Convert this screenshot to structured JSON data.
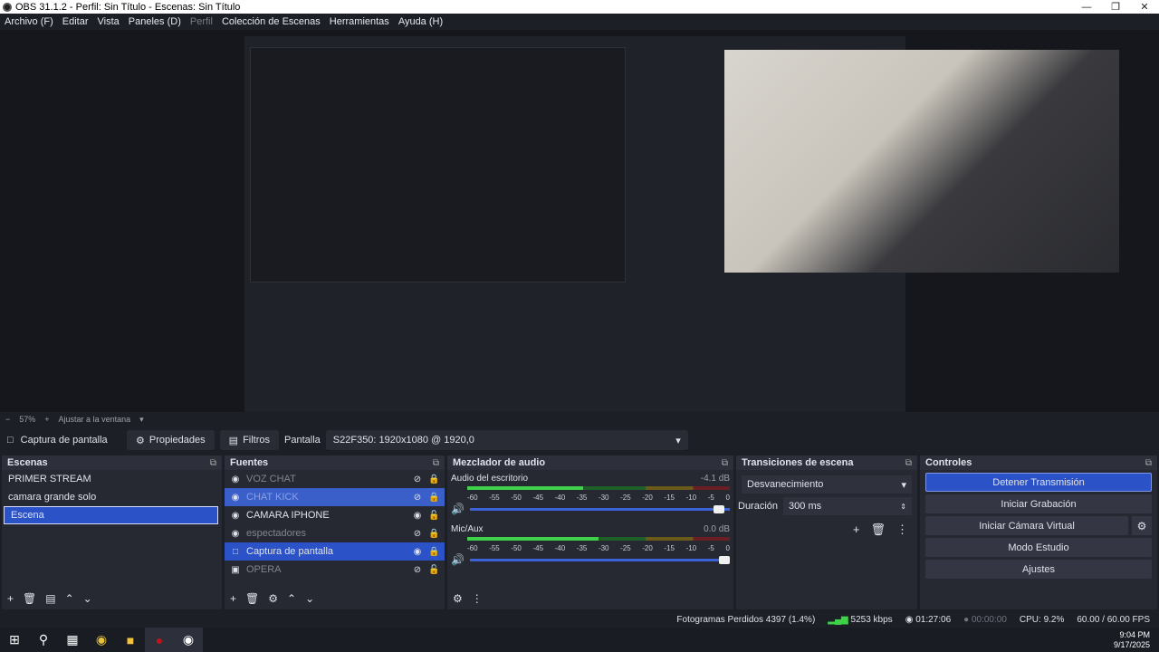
{
  "window": {
    "title": "OBS 31.1.2 - Perfil: Sin Título - Escenas: Sin Título"
  },
  "menu": [
    "Archivo (F)",
    "Editar",
    "Vista",
    "Paneles (D)",
    "Perfil",
    "Colección de Escenas",
    "Herramientas",
    "Ayuda (H)"
  ],
  "zoom": {
    "percent": "57%",
    "fit": "Ajustar a la ventana"
  },
  "source_toolbar": {
    "selected_source": "Captura de pantalla",
    "properties": "Propiedades",
    "filters": "Filtros",
    "display_label": "Pantalla",
    "display_value": "S22F350: 1920x1080 @ 1920,0"
  },
  "scenes": {
    "title": "Escenas",
    "items": [
      "PRIMER STREAM",
      "camara grande solo",
      "Escena"
    ]
  },
  "sources": {
    "title": "Fuentes",
    "items": [
      {
        "name": "VOZ CHAT"
      },
      {
        "name": "CHAT KICK"
      },
      {
        "name": "CAMARA IPHONE"
      },
      {
        "name": "espectadores"
      },
      {
        "name": "Captura de pantalla"
      },
      {
        "name": "OPERA"
      }
    ]
  },
  "mixer": {
    "title": "Mezclador de audio",
    "channels": [
      {
        "name": "Audio del escritorio",
        "db": "-4.1 dB",
        "level": 0.44,
        "volume": 0.98
      },
      {
        "name": "Mic/Aux",
        "db": "0.0 dB",
        "level": 0.5,
        "volume": 1.0
      }
    ],
    "ticks": [
      "-60",
      "-55",
      "-50",
      "-45",
      "-40",
      "-35",
      "-30",
      "-25",
      "-20",
      "-15",
      "-10",
      "-5",
      "0"
    ]
  },
  "transitions": {
    "title": "Transiciones de escena",
    "type": "Desvanecimiento",
    "duration_label": "Duración",
    "duration_value": "300 ms"
  },
  "controls": {
    "title": "Controles",
    "stop_stream": "Detener Transmisión",
    "start_recording": "Iniciar Grabación",
    "virtual_cam": "Iniciar Cámara Virtual",
    "studio_mode": "Modo Estudio",
    "settings": "Ajustes"
  },
  "status": {
    "dropped": "Fotogramas Perdidos 4397 (1.4%)",
    "bitrate": "5253 kbps",
    "stream_time": "01:27:06",
    "rec_time": "00:00:00",
    "cpu": "CPU: 9.2%",
    "fps": "60.00 / 60.00 FPS"
  },
  "clock": {
    "time": "9:04 PM",
    "date": "9/17/2025"
  },
  "colors": {
    "accent": "#2b53c7",
    "panel": "#272932",
    "background": "#1d1f26",
    "meter_green": "#3fd14a"
  }
}
